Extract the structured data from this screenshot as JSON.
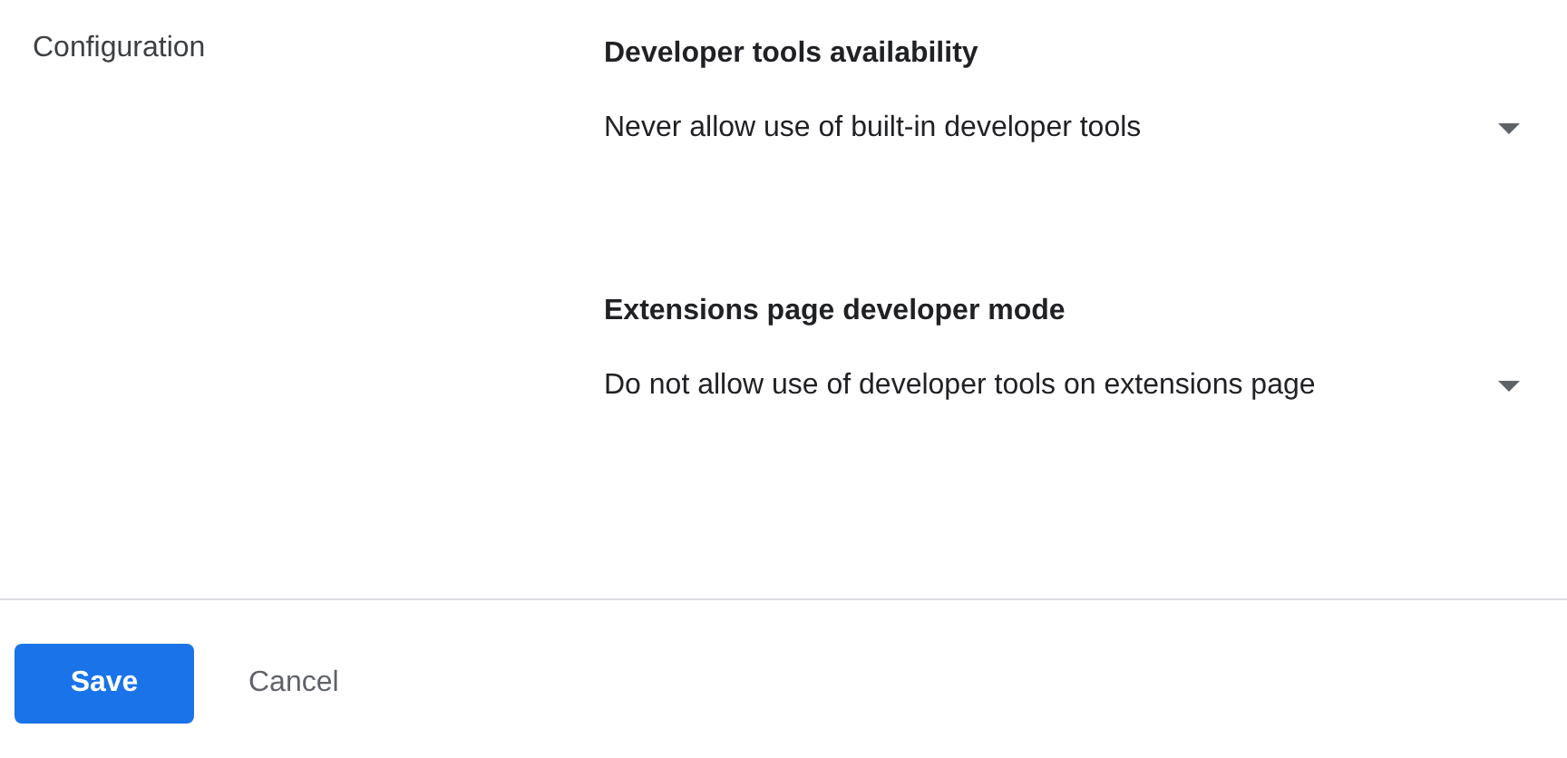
{
  "section_label": "Configuration",
  "settings": [
    {
      "heading": "Developer tools availability",
      "value": "Never allow use of built-in developer tools"
    },
    {
      "heading": "Extensions page developer mode",
      "value": "Do not allow use of developer tools on extensions page"
    }
  ],
  "buttons": [
    {
      "kind": "primary",
      "label": "Save"
    },
    {
      "kind": "text",
      "label": "Cancel"
    }
  ]
}
